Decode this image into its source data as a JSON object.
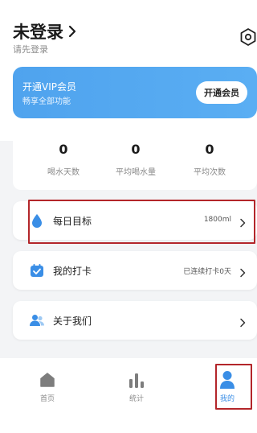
{
  "profile": {
    "title": "未登录",
    "subtitle": "请先登录"
  },
  "vip": {
    "title": "开通VIP会员",
    "subtitle": "畅享全部功能",
    "button_label": "开通会员"
  },
  "stats": [
    {
      "value": "0",
      "label": "喝水天数"
    },
    {
      "value": "0",
      "label": "平均喝水量"
    },
    {
      "value": "0",
      "label": "平均次数"
    }
  ],
  "menu": [
    {
      "label": "每日目标",
      "value": "1800ml",
      "icon": "water-drop-icon"
    },
    {
      "label": "我的打卡",
      "value": "已连续打卡0天",
      "icon": "checkin-icon"
    },
    {
      "label": "关于我们",
      "value": "",
      "icon": "users-icon"
    }
  ],
  "tabs": [
    {
      "label": "首页",
      "icon": "home-icon"
    },
    {
      "label": "统计",
      "icon": "bar-chart-icon"
    },
    {
      "label": "我的",
      "icon": "user-icon",
      "active": true
    }
  ],
  "colors": {
    "accent": "#3a8ee6",
    "vip_gradient_start": "#4fa3ee",
    "highlight_border": "#b3262a"
  }
}
